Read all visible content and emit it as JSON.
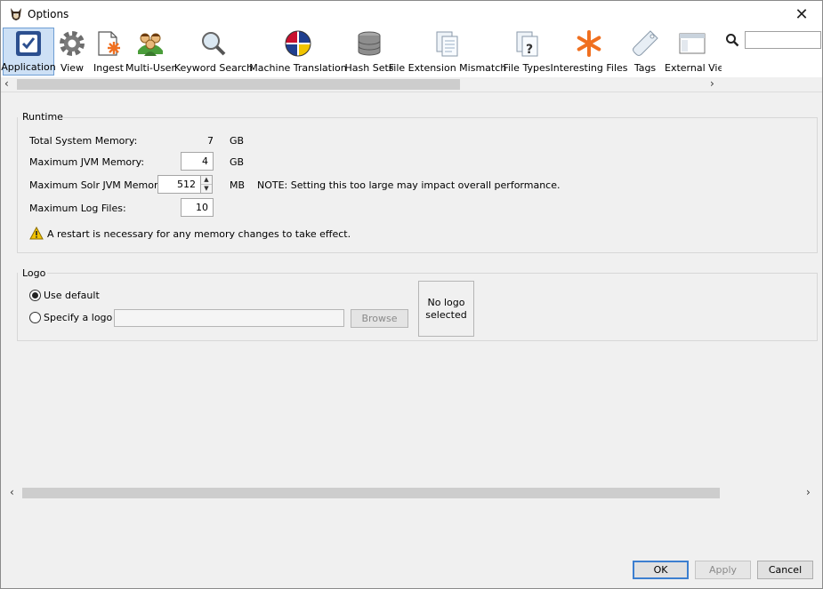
{
  "window": {
    "title": "Options",
    "close_glyph": "✕"
  },
  "toolbar": {
    "items": [
      {
        "label": "Application",
        "icon": "application-check-icon",
        "selected": true
      },
      {
        "label": "View",
        "icon": "gear-icon"
      },
      {
        "label": "Ingest",
        "icon": "ingest-document-icon"
      },
      {
        "label": "Multi-User",
        "icon": "multi-user-icon"
      },
      {
        "label": "Keyword Search",
        "icon": "magnifier-icon"
      },
      {
        "label": "Machine Translation",
        "icon": "globe-flags-icon"
      },
      {
        "label": "Hash Sets",
        "icon": "database-icon"
      },
      {
        "label": "File Extension Mismatch",
        "icon": "documents-icon"
      },
      {
        "label": "File Types",
        "icon": "file-question-icon"
      },
      {
        "label": "Interesting Files",
        "icon": "asterisk-icon"
      },
      {
        "label": "Tags",
        "icon": "tag-icon"
      },
      {
        "label": "External View",
        "icon": "window-icon"
      }
    ],
    "search_value": ""
  },
  "runtime": {
    "group_label": "Runtime",
    "total_memory_label": "Total System Memory:",
    "total_memory_value": "7",
    "total_memory_unit": "GB",
    "max_jvm_label": "Maximum JVM Memory:",
    "max_jvm_value": "4",
    "max_jvm_unit": "GB",
    "max_solr_label": "Maximum Solr JVM Memory:",
    "max_solr_value": "512",
    "max_solr_unit": "MB",
    "solr_note": "NOTE:  Setting this too large may impact overall performance.",
    "max_log_label": "Maximum Log Files:",
    "max_log_value": "10",
    "restart_warning": "A restart is necessary for any memory changes to take effect."
  },
  "logo": {
    "group_label": "Logo",
    "use_default_label": "Use default",
    "specify_label": "Specify a logo",
    "path_value": "",
    "browse_label": "Browse",
    "preview_line1": "No logo",
    "preview_line2": "selected"
  },
  "footer": {
    "ok_label": "OK",
    "apply_label": "Apply",
    "cancel_label": "Cancel"
  },
  "colors": {
    "selected_bg": "#cde0f5",
    "accent": "#3c7fd0",
    "warning": "#f2c200"
  }
}
